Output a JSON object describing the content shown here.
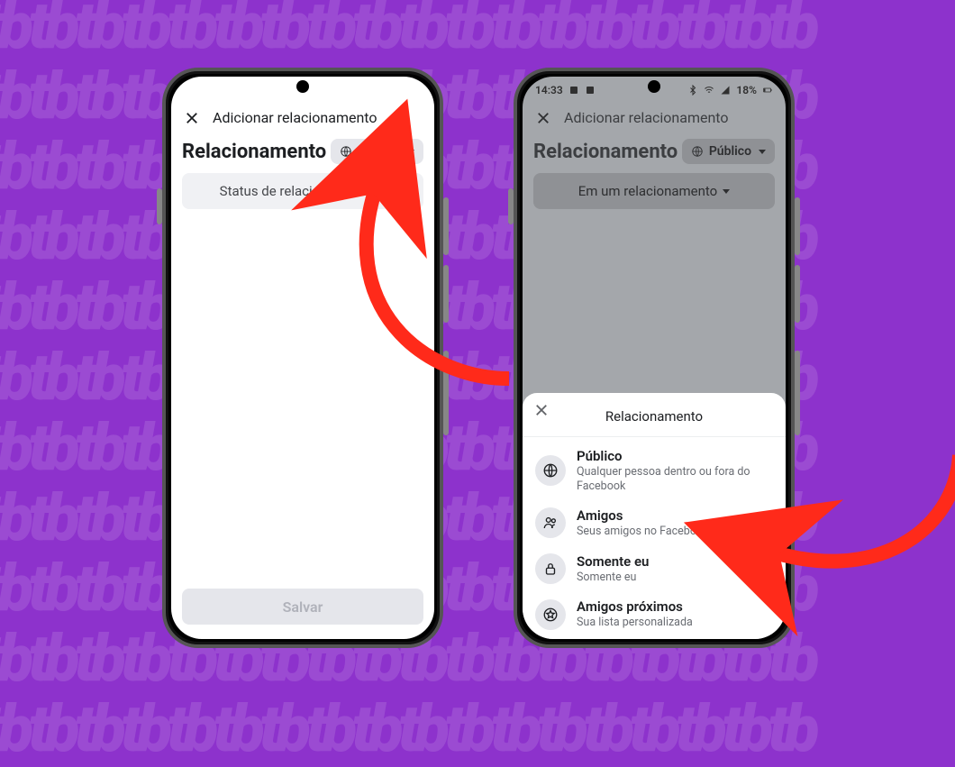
{
  "annotation_color": "#ff2a1a",
  "phone1": {
    "header": {
      "title": "Adicionar relacionamento"
    },
    "section_title": "Relacionamento",
    "audience_button": {
      "label": "Público",
      "icon": "globe-icon"
    },
    "status_button": {
      "label": "Status de relacionamento"
    },
    "save_button": {
      "label": "Salvar",
      "enabled": false
    }
  },
  "phone2": {
    "statusbar": {
      "time": "14:33",
      "battery": "18%"
    },
    "header": {
      "title": "Adicionar relacionamento"
    },
    "section_title": "Relacionamento",
    "audience_button": {
      "label": "Público",
      "icon": "globe-icon"
    },
    "status_button": {
      "label": "Em um relacionamento"
    },
    "sheet": {
      "title": "Relacionamento",
      "options": [
        {
          "icon": "globe-icon",
          "label": "Público",
          "sub": "Qualquer pessoa dentro ou fora do Facebook"
        },
        {
          "icon": "friends-icon",
          "label": "Amigos",
          "sub": "Seus amigos no Facebook"
        },
        {
          "icon": "lock-icon",
          "label": "Somente eu",
          "sub": "Somente eu"
        },
        {
          "icon": "star-icon",
          "label": "Amigos próximos",
          "sub": "Sua lista personalizada"
        }
      ]
    }
  }
}
